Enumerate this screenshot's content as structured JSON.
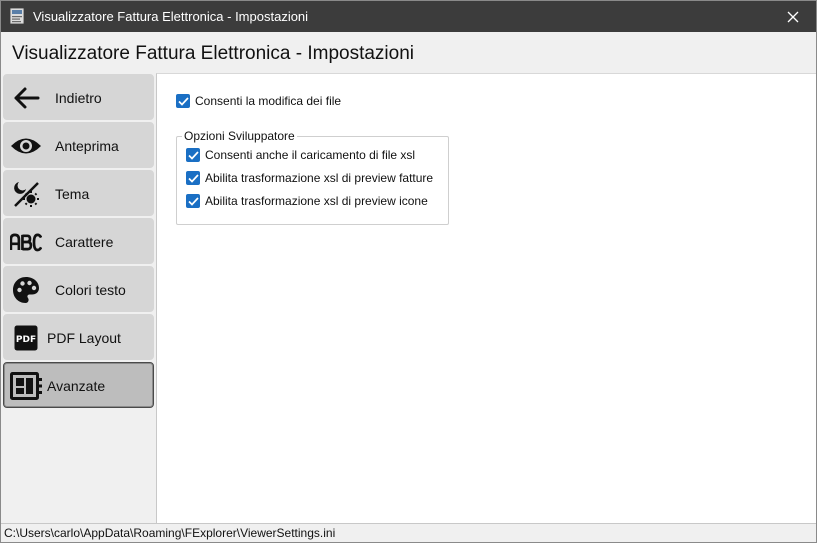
{
  "window": {
    "title": "Visualizzatore Fattura Elettronica - Impostazioni",
    "close_icon": "close-icon",
    "app_icon": "xml-document-icon"
  },
  "header": {
    "title": "Visualizzatore Fattura Elettronica - Impostazioni"
  },
  "sidebar": {
    "items": [
      {
        "label": "Indietro",
        "icon": "arrow-left-icon",
        "active": false
      },
      {
        "label": "Anteprima",
        "icon": "eye-icon",
        "active": false
      },
      {
        "label": "Tema",
        "icon": "theme-toggle-icon",
        "active": false
      },
      {
        "label": "Carattere",
        "icon": "abc-font-icon",
        "active": false
      },
      {
        "label": "Colori testo",
        "icon": "palette-icon",
        "active": false
      },
      {
        "label": "PDF Layout",
        "icon": "pdf-icon",
        "active": false
      },
      {
        "label": "Avanzate",
        "icon": "advanced-layout-icon",
        "active": true
      }
    ]
  },
  "main": {
    "allow_edit": {
      "label": "Consenti la modifica dei file",
      "checked": true
    },
    "developer_group": {
      "title": "Opzioni Sviluppatore",
      "options": [
        {
          "label": "Consenti anche il caricamento di file xsl",
          "checked": true
        },
        {
          "label": "Abilita trasformazione xsl di preview fatture",
          "checked": true
        },
        {
          "label": "Abilita trasformazione xsl di preview icone",
          "checked": true
        }
      ]
    }
  },
  "status": {
    "path": "C:\\Users\\carlo\\AppData\\Roaming\\FExplorer\\ViewerSettings.ini"
  },
  "colors": {
    "titlebar_bg": "#3c3c3c",
    "checkbox_accent": "#1a6fc4",
    "nav_button_bg": "#d6d6d6",
    "nav_button_active_bg": "#bdbdbd"
  }
}
